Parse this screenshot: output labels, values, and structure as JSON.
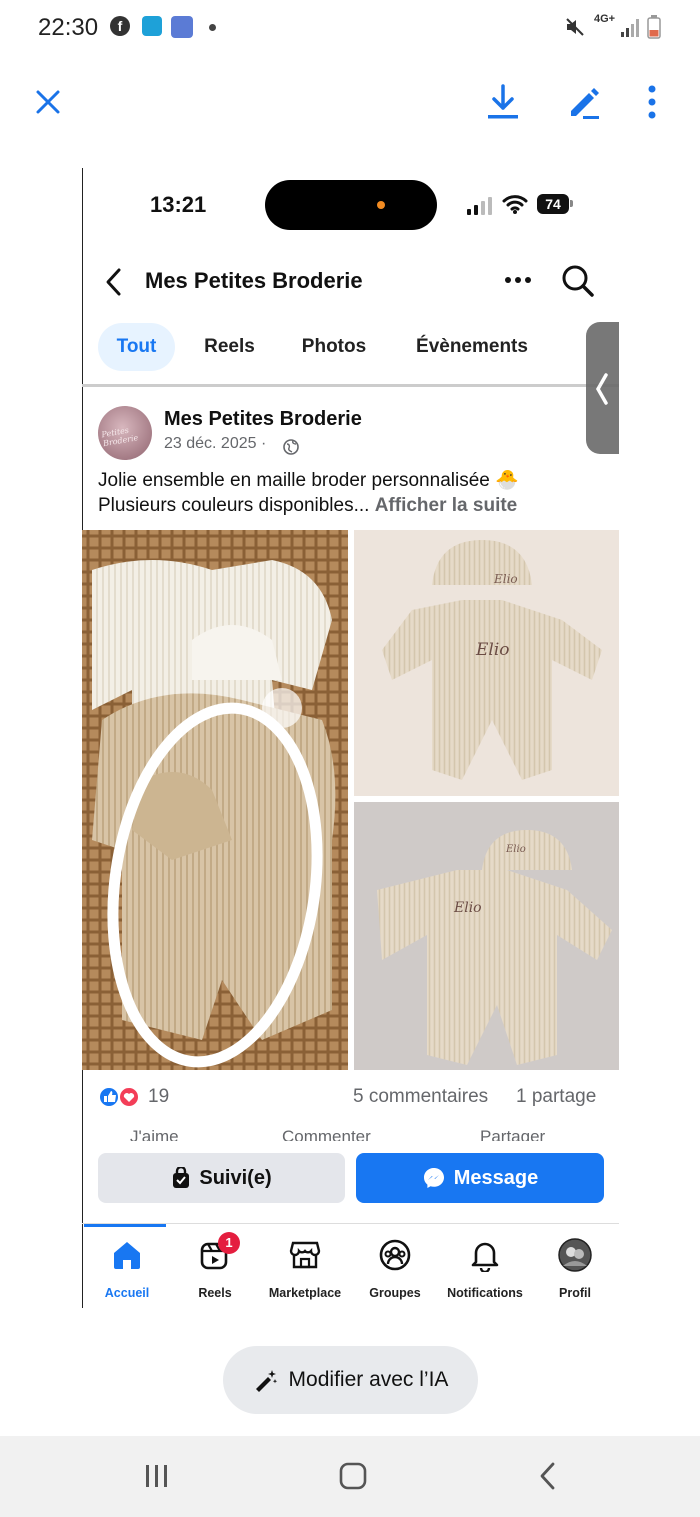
{
  "status_bar": {
    "time": "22:30",
    "network": "4G+"
  },
  "viewer": {
    "close_icon": "close-icon",
    "download_icon": "download-icon",
    "edit_icon": "pen-icon",
    "more_icon": "more-vertical-icon",
    "ai_button_label": "Modifier avec l’IA"
  },
  "screenshot": {
    "ios_time": "13:21",
    "battery": "74",
    "page_title": "Mes Petites Broderie",
    "tabs": [
      {
        "label": "Tout",
        "active": true
      },
      {
        "label": "Reels",
        "active": false
      },
      {
        "label": "Photos",
        "active": false
      },
      {
        "label": "Évènements",
        "active": false
      }
    ],
    "post": {
      "author": "Mes Petites Broderie",
      "date": "23 déc. 2025 ·",
      "text_line1": "Jolie ensemble en maille broder personnalisée 🐣",
      "text_line2": "Plusieurs couleurs disponibles...",
      "see_more": "Afficher la suite",
      "photo_caption_1": "Elio",
      "photo_caption_2": "Elio",
      "photo_caption_3": "Elio",
      "photo_caption_4": "Elio",
      "reaction_count": "19",
      "comments": "5 commentaires",
      "shares": "1 partage",
      "action_like": "J'aime",
      "action_comment": "Commenter",
      "action_share": "Partager"
    },
    "follow_button": "Suivi(e)",
    "message_button": "Message",
    "bottom_nav": [
      {
        "label": "Accueil",
        "icon": "home-icon",
        "active": true
      },
      {
        "label": "Reels",
        "icon": "reels-icon",
        "badge": "1"
      },
      {
        "label": "Marketplace",
        "icon": "marketplace-icon"
      },
      {
        "label": "Groupes",
        "icon": "groups-icon"
      },
      {
        "label": "Notifications",
        "icon": "bell-icon"
      },
      {
        "label": "Profil",
        "icon": "profile-avatar"
      }
    ]
  },
  "colors": {
    "accent": "#1877f2",
    "viewer_icon": "#1a73e8"
  }
}
